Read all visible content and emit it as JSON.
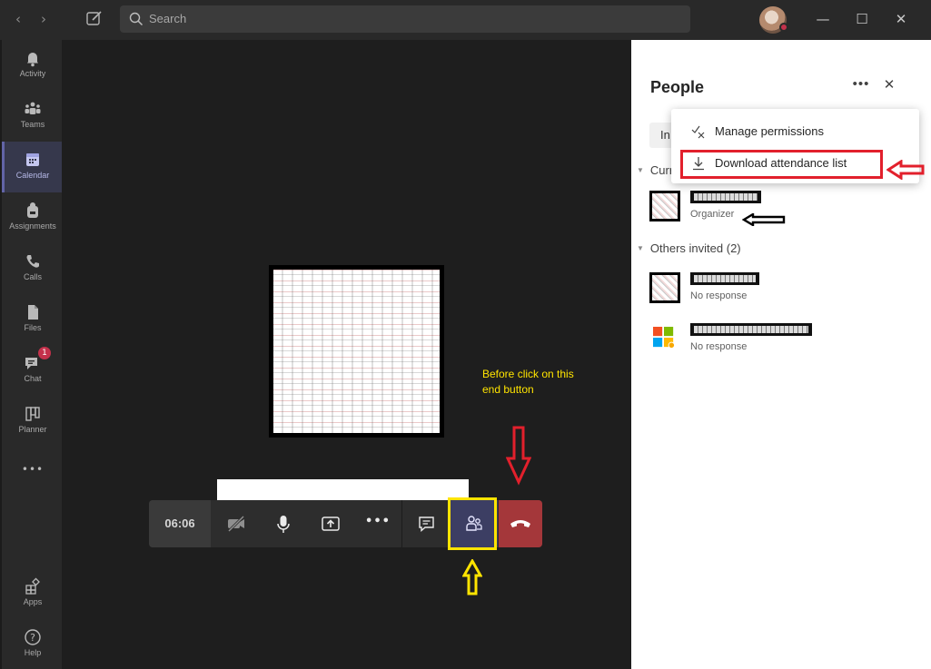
{
  "titlebar": {
    "search_placeholder": "Search",
    "back_icon": "chevron-left-icon",
    "forward_icon": "chevron-right-icon",
    "compose_icon": "compose-icon",
    "window_controls": [
      "minimize-icon",
      "maximize-icon",
      "close-icon"
    ]
  },
  "rail": {
    "items": [
      {
        "label": "Activity",
        "icon": "bell-icon"
      },
      {
        "label": "Teams",
        "icon": "teams-icon"
      },
      {
        "label": "Calendar",
        "icon": "calendar-icon",
        "active": true
      },
      {
        "label": "Assignments",
        "icon": "backpack-icon"
      },
      {
        "label": "Calls",
        "icon": "phone-icon"
      },
      {
        "label": "Files",
        "icon": "file-icon"
      },
      {
        "label": "Chat",
        "icon": "chat-icon",
        "badge": "1"
      },
      {
        "label": "Planner",
        "icon": "planner-icon"
      }
    ],
    "more": "•••",
    "bottom": [
      {
        "label": "Apps",
        "icon": "apps-icon"
      },
      {
        "label": "Help",
        "icon": "help-icon"
      }
    ]
  },
  "call": {
    "timer": "06:06",
    "note_line1": "Before click on this",
    "note_line2": "end button",
    "more_label": "•••",
    "controls": [
      "video-off-icon",
      "microphone-icon",
      "share-screen-icon",
      "more-icon",
      "chat-icon",
      "people-icon",
      "hang-up-icon"
    ]
  },
  "panel": {
    "title": "People",
    "more": "•••",
    "close": "✕",
    "invite_partial": "In",
    "current_partial": "Curr",
    "organizer_role": "Organizer",
    "others_header": "Others invited (2)",
    "invited": [
      {
        "status": "No response"
      },
      {
        "status": "No response"
      }
    ]
  },
  "menu": {
    "items": [
      {
        "label": "Manage permissions",
        "icon": "manage-permissions-icon"
      },
      {
        "label": "Download attendance list",
        "icon": "download-icon"
      }
    ]
  },
  "colors": {
    "accent": "#6264a7",
    "hangup": "#a4373a",
    "highlight_red": "#e2202c",
    "highlight_yellow": "#ffe400"
  }
}
